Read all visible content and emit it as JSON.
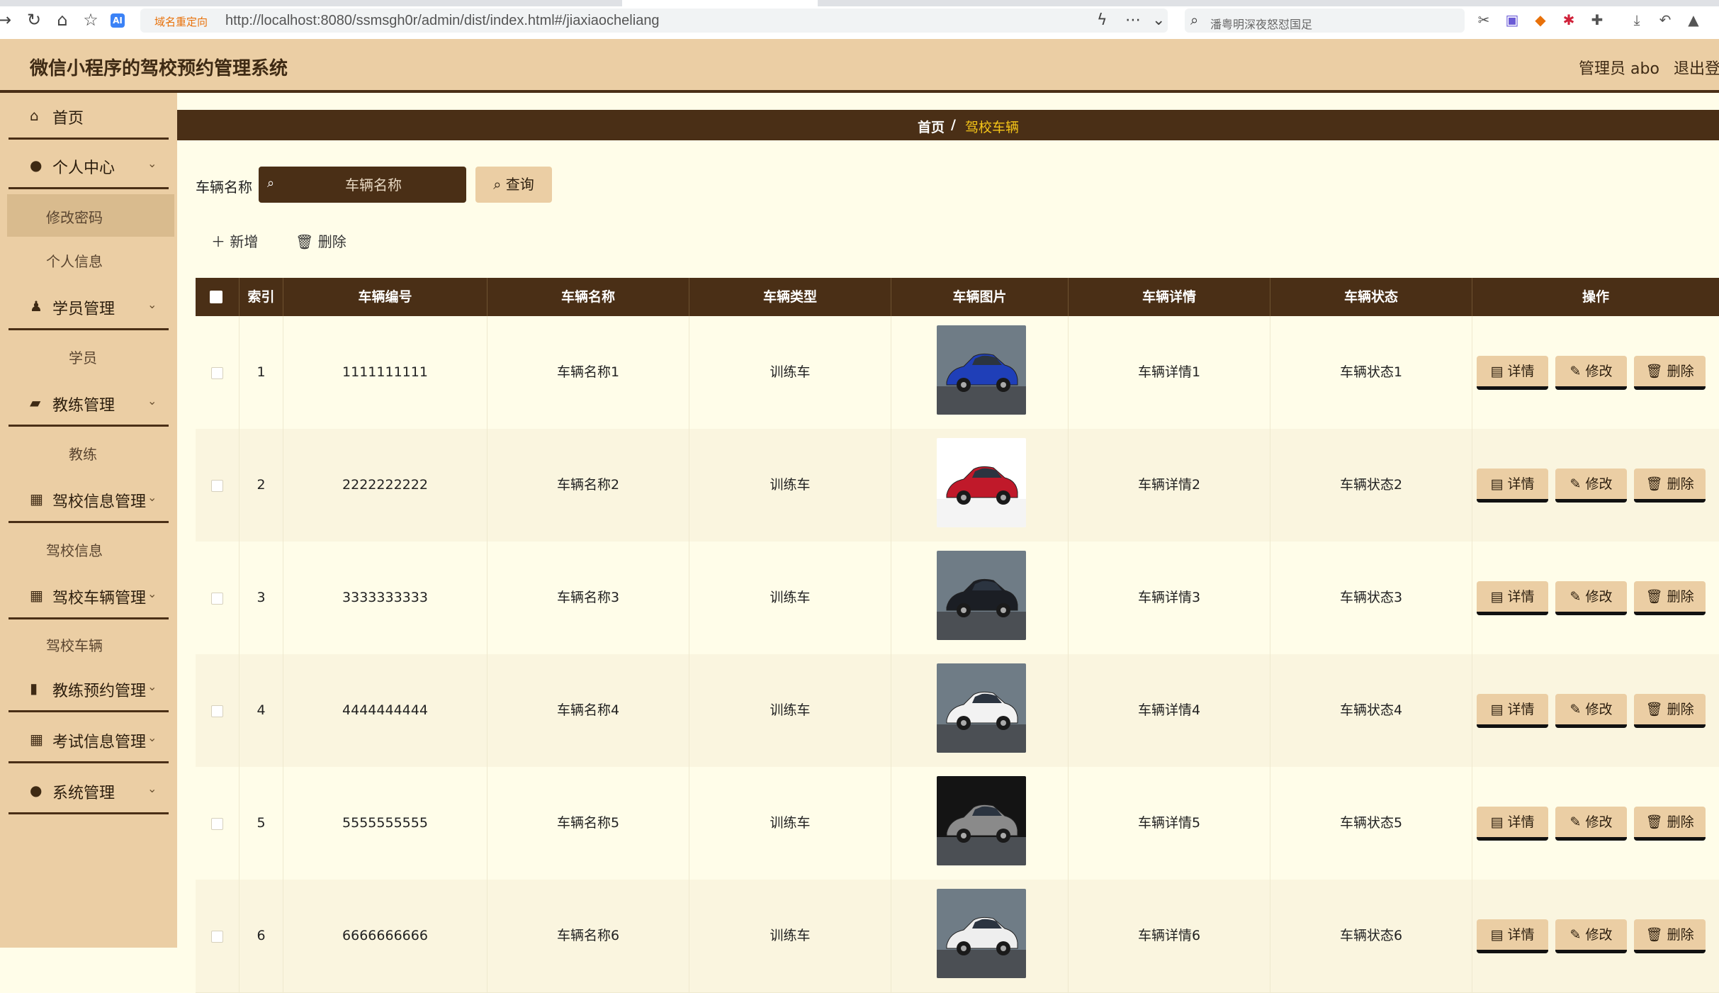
{
  "browser": {
    "redirect_tag": "域名重定向",
    "url": "http://localhost:8080/ssmsgh0r/admin/dist/index.html#/jiaxiaocheliang",
    "search_text": "潘粤明深夜怒怼国足",
    "ai_badge": "AI"
  },
  "header": {
    "title": "微信小程序的驾校预约管理系统",
    "user": "管理员 abo",
    "logout": "退出登录"
  },
  "sidebar": {
    "items": [
      {
        "label": "首页",
        "icon": "home-icon"
      },
      {
        "label": "个人中心",
        "icon": "user-icon"
      },
      {
        "label": "修改密码"
      },
      {
        "label": "个人信息"
      },
      {
        "label": "学员管理",
        "icon": "student-icon"
      },
      {
        "label": "学员"
      },
      {
        "label": "教练管理",
        "icon": "coach-icon"
      },
      {
        "label": "教练"
      },
      {
        "label": "驾校信息管理",
        "icon": "grid-icon"
      },
      {
        "label": "驾校信息"
      },
      {
        "label": "驾校车辆管理",
        "icon": "grid-icon"
      },
      {
        "label": "驾校车辆"
      },
      {
        "label": "教练预约管理",
        "icon": "bar-chart-icon"
      },
      {
        "label": "考试信息管理",
        "icon": "grid-icon"
      },
      {
        "label": "系统管理",
        "icon": "location-icon"
      }
    ]
  },
  "breadcrumb": {
    "home": "首页",
    "separator": "/",
    "current": "驾校车辆"
  },
  "search": {
    "label": "车辆名称",
    "placeholder": "车辆名称",
    "button": "查询"
  },
  "actions": {
    "add": "新增",
    "delete": "删除"
  },
  "table": {
    "headers": [
      "索引",
      "车辆编号",
      "车辆名称",
      "车辆类型",
      "车辆图片",
      "车辆详情",
      "车辆状态",
      "操作"
    ],
    "op_labels": {
      "detail": "详情",
      "edit": "修改",
      "delete": "删除"
    },
    "rows": [
      {
        "index": "1",
        "code": "1111111111",
        "name": "车辆名称1",
        "type": "训练车",
        "detail": "车辆详情1",
        "status": "车辆状态1",
        "car_color": "#1f3fb8"
      },
      {
        "index": "2",
        "code": "2222222222",
        "name": "车辆名称2",
        "type": "训练车",
        "detail": "车辆详情2",
        "status": "车辆状态2",
        "car_color": "#c0192a"
      },
      {
        "index": "3",
        "code": "3333333333",
        "name": "车辆名称3",
        "type": "训练车",
        "detail": "车辆详情3",
        "status": "车辆状态3",
        "car_color": "#1b1e24"
      },
      {
        "index": "4",
        "code": "4444444444",
        "name": "车辆名称4",
        "type": "训练车",
        "detail": "车辆详情4",
        "status": "车辆状态4",
        "car_color": "#f2f2f2"
      },
      {
        "index": "5",
        "code": "5555555555",
        "name": "车辆名称5",
        "type": "训练车",
        "detail": "车辆详情5",
        "status": "车辆状态5",
        "car_color": "#8a8a8a"
      },
      {
        "index": "6",
        "code": "6666666666",
        "name": "车辆名称6",
        "type": "训练车",
        "detail": "车辆详情6",
        "status": "车辆状态6",
        "car_color": "#eeeeee"
      }
    ]
  },
  "colors": {
    "accent_dark": "#4a2f16",
    "accent_light": "#ebcea4",
    "background": "#fffde9",
    "breadcrumb_current": "#f5c518"
  }
}
